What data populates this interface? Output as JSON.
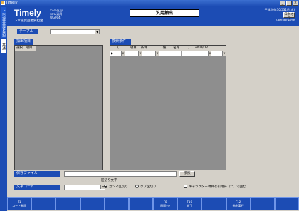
{
  "window": {
    "title": "Timely",
    "btn_min": "_",
    "btn_max": "□",
    "btn_close": "×"
  },
  "sidebar": {
    "tab1": "下水道受益者負担金",
    "tab2": "共通"
  },
  "header": {
    "logo": "Timely",
    "logo_sub": "下水道受益者負担金",
    "sys_line1": "ｴﾝﾄﾘｰ区分",
    "sys_line2": "ｼｽﾃﾑ 汎用",
    "sys_line3": "WG004",
    "screen_title": "汎用抽出",
    "date": "平成20年10月31日(水)",
    "logout_label": "ログオフ",
    "operator": "OperatorName"
  },
  "table": {
    "label": "テーブル"
  },
  "extract": {
    "label": "抽出項目",
    "col_select": "選択",
    "col_item": "項目"
  },
  "search": {
    "label": "検索条件",
    "cols": [
      "(",
      "項目",
      "条件",
      "値",
      "名称",
      ")",
      "AND/OR"
    ],
    "row_marker": "▶"
  },
  "save": {
    "label": "保存ファイル",
    "ref_button": "参照"
  },
  "delimiter": {
    "title": "区切り文字",
    "comma": "カンマ区切り",
    "tab": "タブ区切り",
    "quote_check": "キャラクター項目を引用符（\"\"）で囲む"
  },
  "code": {
    "label": "文字コード"
  },
  "fkeys": [
    {
      "key": "F1",
      "label": "コード参照"
    },
    {
      "key": "",
      "label": ""
    },
    {
      "key": "",
      "label": ""
    },
    {
      "key": "",
      "label": ""
    },
    {
      "key": "",
      "label": ""
    },
    {
      "key": "",
      "label": ""
    },
    {
      "key": "F8",
      "label": "画面ｸﾘｱ"
    },
    {
      "key": "F10",
      "label": "終了"
    },
    {
      "key": "",
      "label": ""
    },
    {
      "key": "F12",
      "label": "抽出実行"
    },
    {
      "key": "",
      "label": ""
    },
    {
      "key": "",
      "label": ""
    }
  ]
}
